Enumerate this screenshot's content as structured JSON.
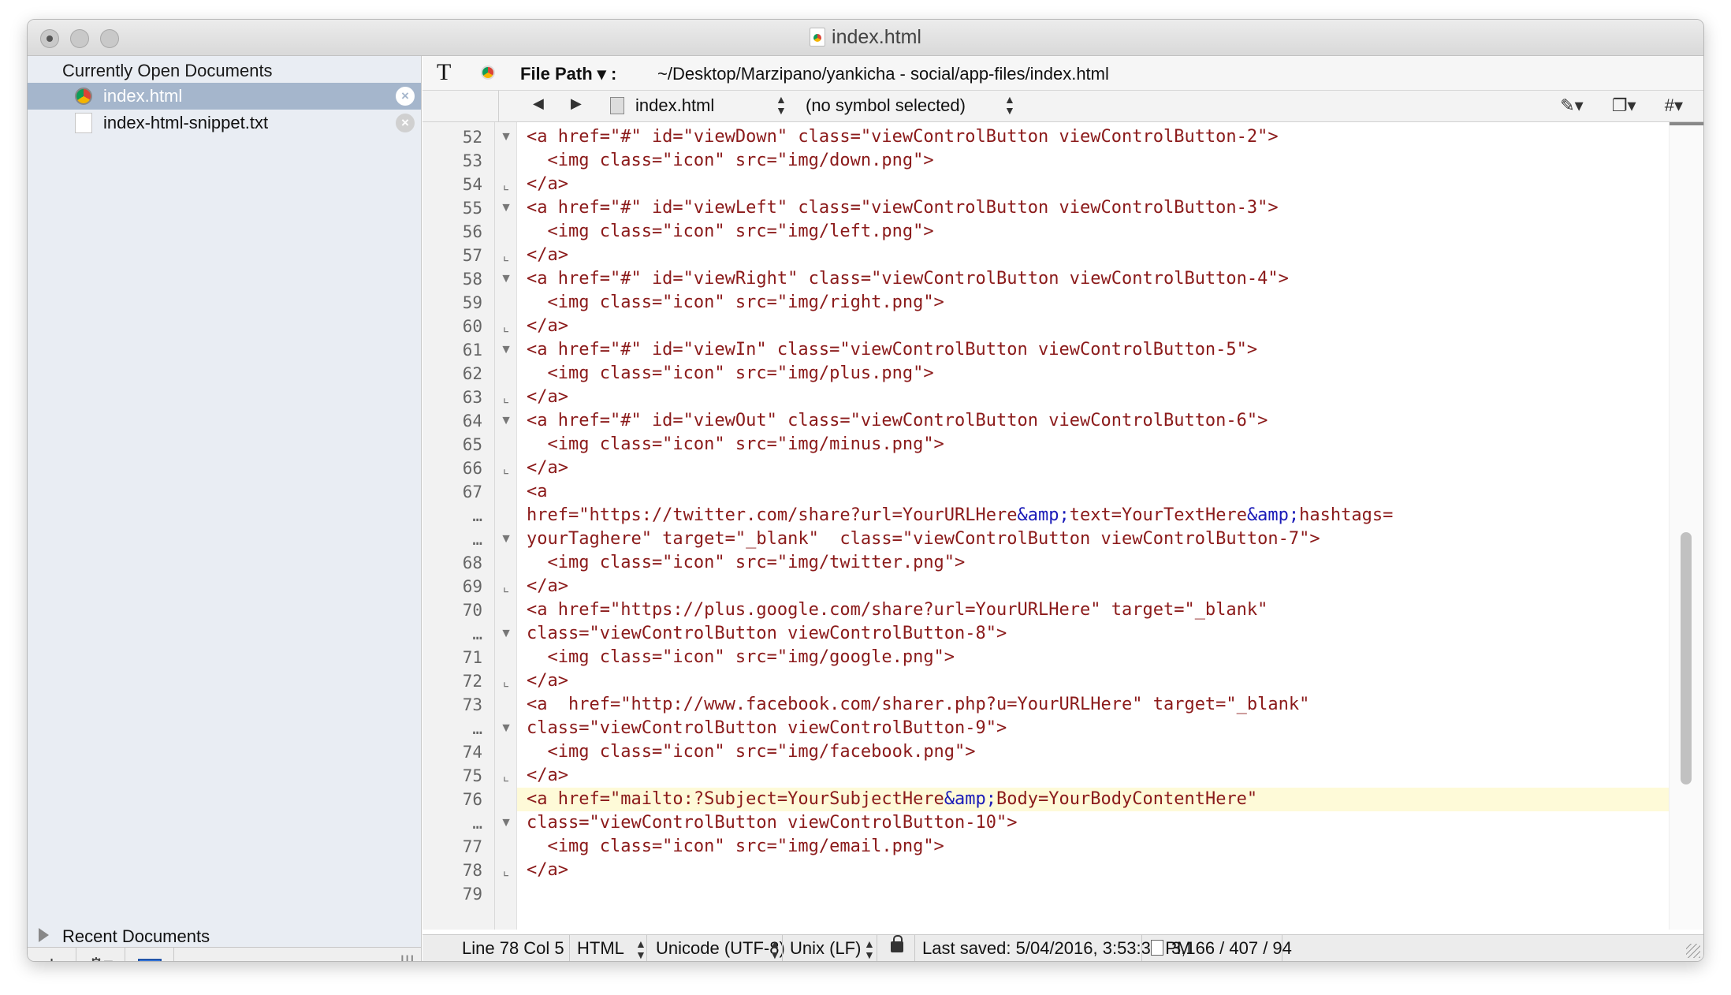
{
  "window": {
    "title": "index.html"
  },
  "sidebar": {
    "heading": "Currently Open Documents",
    "items": [
      {
        "label": "index.html",
        "selected": true,
        "icon": "chrome-icon"
      },
      {
        "label": "index-html-snippet.txt",
        "selected": false,
        "icon": "text-file-icon"
      }
    ],
    "recent_label": "Recent Documents",
    "bottom": {
      "add": "+",
      "gear": "⚙▾",
      "grip": "|||"
    }
  },
  "pathbar": {
    "label": "File Path ▾ :",
    "value": "~/Desktop/Marzipano/yankicha - social/app-files/index.html"
  },
  "navbar": {
    "file": "index.html",
    "symbol": "(no symbol selected)",
    "tools": [
      "✎▾",
      "❐▾",
      "#▾"
    ]
  },
  "editor": {
    "current_line_index": 28,
    "lines": [
      {
        "n": "52",
        "f": "open",
        "t": "<a href=\"#\" id=\"viewDown\" class=\"viewControlButton viewControlButton-2\">"
      },
      {
        "n": "53",
        "f": "",
        "t": "  <img class=\"icon\" src=\"img/down.png\">"
      },
      {
        "n": "54",
        "f": "close",
        "t": "</a>"
      },
      {
        "n": "55",
        "f": "open",
        "t": "<a href=\"#\" id=\"viewLeft\" class=\"viewControlButton viewControlButton-3\">"
      },
      {
        "n": "56",
        "f": "",
        "t": "  <img class=\"icon\" src=\"img/left.png\">"
      },
      {
        "n": "57",
        "f": "close",
        "t": "</a>"
      },
      {
        "n": "58",
        "f": "open",
        "t": "<a href=\"#\" id=\"viewRight\" class=\"viewControlButton viewControlButton-4\">"
      },
      {
        "n": "59",
        "f": "",
        "t": "  <img class=\"icon\" src=\"img/right.png\">"
      },
      {
        "n": "60",
        "f": "close",
        "t": "</a>"
      },
      {
        "n": "61",
        "f": "open",
        "t": "<a href=\"#\" id=\"viewIn\" class=\"viewControlButton viewControlButton-5\">"
      },
      {
        "n": "62",
        "f": "",
        "t": "  <img class=\"icon\" src=\"img/plus.png\">"
      },
      {
        "n": "63",
        "f": "close",
        "t": "</a>"
      },
      {
        "n": "64",
        "f": "open",
        "t": "<a href=\"#\" id=\"viewOut\" class=\"viewControlButton viewControlButton-6\">"
      },
      {
        "n": "65",
        "f": "",
        "t": "  <img class=\"icon\" src=\"img/minus.png\">"
      },
      {
        "n": "66",
        "f": "close",
        "t": "</a>"
      },
      {
        "n": "67",
        "f": "",
        "t": "<a"
      },
      {
        "n": "…",
        "f": "",
        "t": "href=\"https://twitter.com/share?url=YourURLHere&amp;text=YourTextHere&amp;hashtags="
      },
      {
        "n": "…",
        "f": "open",
        "t": "yourTaghere\" target=\"_blank\"  class=\"viewControlButton viewControlButton-7\">"
      },
      {
        "n": "68",
        "f": "",
        "t": "  <img class=\"icon\" src=\"img/twitter.png\">"
      },
      {
        "n": "69",
        "f": "close",
        "t": "</a>"
      },
      {
        "n": "70",
        "f": "",
        "t": "<a href=\"https://plus.google.com/share?url=YourURLHere\" target=\"_blank\""
      },
      {
        "n": "…",
        "f": "open",
        "t": "class=\"viewControlButton viewControlButton-8\">"
      },
      {
        "n": "71",
        "f": "",
        "t": "  <img class=\"icon\" src=\"img/google.png\">"
      },
      {
        "n": "72",
        "f": "close",
        "t": "</a>"
      },
      {
        "n": "73",
        "f": "",
        "t": "<a  href=\"http://www.facebook.com/sharer.php?u=YourURLHere\" target=\"_blank\""
      },
      {
        "n": "…",
        "f": "open",
        "t": "class=\"viewControlButton viewControlButton-9\">"
      },
      {
        "n": "74",
        "f": "",
        "t": "  <img class=\"icon\" src=\"img/facebook.png\">"
      },
      {
        "n": "75",
        "f": "close",
        "t": "</a>"
      },
      {
        "n": "76",
        "f": "",
        "t": "<a href=\"mailto:?Subject=YourSubjectHere&amp;Body=YourBodyContentHere\""
      },
      {
        "n": "…",
        "f": "open",
        "t": "class=\"viewControlButton viewControlButton-10\">"
      },
      {
        "n": "77",
        "f": "",
        "t": "  <img class=\"icon\" src=\"img/email.png\">"
      },
      {
        "n": "78",
        "f": "close",
        "t": "</a>"
      },
      {
        "n": "79",
        "f": "",
        "t": ""
      }
    ]
  },
  "status": {
    "position": "Line 78 Col 5",
    "language": "HTML",
    "encoding": "Unicode (UTF-8)",
    "line_endings": "Unix (LF)",
    "saved": "Last saved: 5/04/2016, 3:53:37 PM",
    "counts": "3,166 / 407 / 94"
  }
}
